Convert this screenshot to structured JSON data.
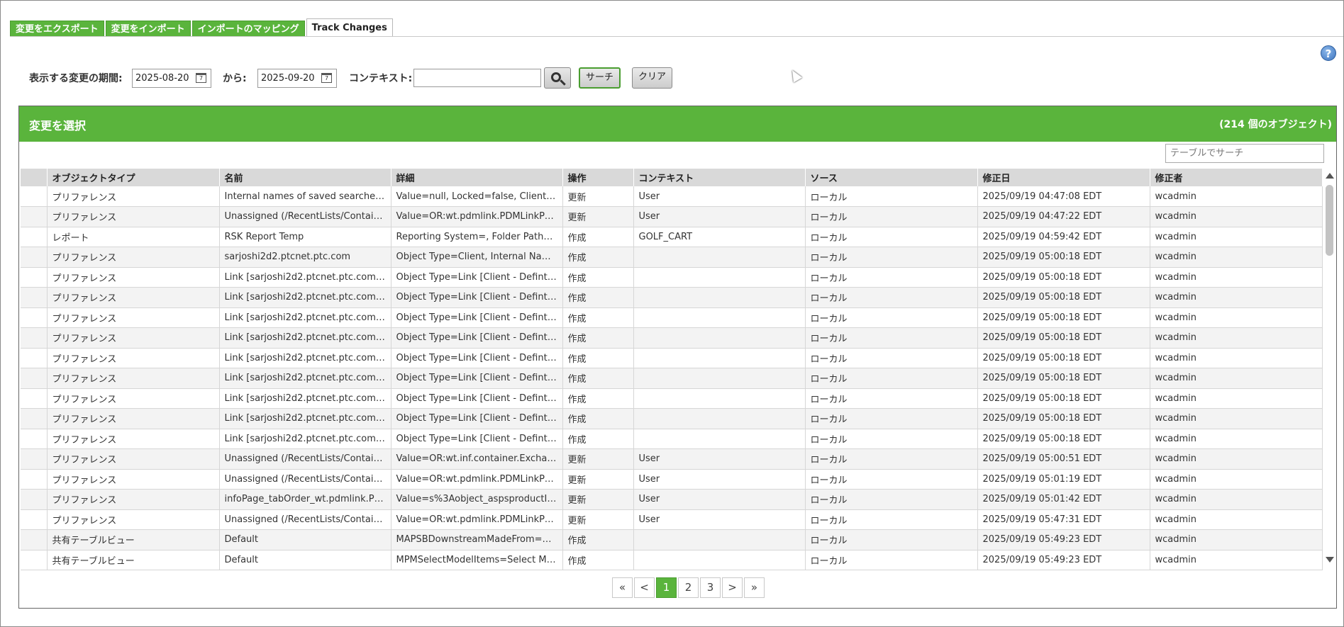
{
  "tabs": [
    {
      "label": "変更をエクスポート"
    },
    {
      "label": "変更をインポート"
    },
    {
      "label": "インポートのマッピング"
    },
    {
      "label": "Track Changes"
    }
  ],
  "help": {
    "symbol": "?"
  },
  "filter": {
    "period_label": "表示する変更の期間:",
    "from_date": "2025-08-20",
    "to_label": "から:",
    "to_date": "2025-09-20",
    "context_label": "コンテキスト:",
    "context_value": "",
    "search_button": "サーチ",
    "clear_button": "クリア"
  },
  "panel": {
    "title": "変更を選択",
    "count": "(214 個のオブジェクト)",
    "table_search_placeholder": "テーブルでサーチ"
  },
  "table": {
    "columns": [
      "オブジェクトタイプ",
      "名前",
      "詳細",
      "操作",
      "コンテキスト",
      "ソース",
      "修正日",
      "修正者"
    ],
    "rows": [
      [
        "プリファレンス",
        "Internal names of saved searches f...",
        "Value=null, Locked=false, Client=...",
        "更新",
        "User",
        "ローカル",
        "2025/09/19 04:47:08 EDT",
        "wcadmin"
      ],
      [
        "プリファレンス",
        "Unassigned (/RecentLists/Contain...",
        "Value=OR:wt.pdmlink.PDMLinkPro...",
        "更新",
        "User",
        "ローカル",
        "2025/09/19 04:47:22 EDT",
        "wcadmin"
      ],
      [
        "レポート",
        "RSK Report Temp",
        "Reporting System=, Folder Path=n...",
        "作成",
        "GOLF_CART",
        "ローカル",
        "2025/09/19 04:59:42 EDT",
        "wcadmin"
      ],
      [
        "プリファレンス",
        "sarjoshi2d2.ptcnet.ptc.com",
        "Object Type=Client, Internal Name...",
        "作成",
        "",
        "ローカル",
        "2025/09/19 05:00:18 EDT",
        "wcadmin"
      ],
      [
        "プリファレンス",
        "Link [sarjoshi2d2.ptcnet.ptc.com - ...",
        "Object Type=Link [Client - Defintio...",
        "作成",
        "",
        "ローカル",
        "2025/09/19 05:00:18 EDT",
        "wcadmin"
      ],
      [
        "プリファレンス",
        "Link [sarjoshi2d2.ptcnet.ptc.com - ...",
        "Object Type=Link [Client - Defintio...",
        "作成",
        "",
        "ローカル",
        "2025/09/19 05:00:18 EDT",
        "wcadmin"
      ],
      [
        "プリファレンス",
        "Link [sarjoshi2d2.ptcnet.ptc.com - ...",
        "Object Type=Link [Client - Defintio...",
        "作成",
        "",
        "ローカル",
        "2025/09/19 05:00:18 EDT",
        "wcadmin"
      ],
      [
        "プリファレンス",
        "Link [sarjoshi2d2.ptcnet.ptc.com - ...",
        "Object Type=Link [Client - Defintio...",
        "作成",
        "",
        "ローカル",
        "2025/09/19 05:00:18 EDT",
        "wcadmin"
      ],
      [
        "プリファレンス",
        "Link [sarjoshi2d2.ptcnet.ptc.com - ...",
        "Object Type=Link [Client - Defintio...",
        "作成",
        "",
        "ローカル",
        "2025/09/19 05:00:18 EDT",
        "wcadmin"
      ],
      [
        "プリファレンス",
        "Link [sarjoshi2d2.ptcnet.ptc.com - ...",
        "Object Type=Link [Client - Defintio...",
        "作成",
        "",
        "ローカル",
        "2025/09/19 05:00:18 EDT",
        "wcadmin"
      ],
      [
        "プリファレンス",
        "Link [sarjoshi2d2.ptcnet.ptc.com - ...",
        "Object Type=Link [Client - Defintio...",
        "作成",
        "",
        "ローカル",
        "2025/09/19 05:00:18 EDT",
        "wcadmin"
      ],
      [
        "プリファレンス",
        "Link [sarjoshi2d2.ptcnet.ptc.com - ...",
        "Object Type=Link [Client - Defintio...",
        "作成",
        "",
        "ローカル",
        "2025/09/19 05:00:18 EDT",
        "wcadmin"
      ],
      [
        "プリファレンス",
        "Link [sarjoshi2d2.ptcnet.ptc.com - ...",
        "Object Type=Link [Client - Defintio...",
        "作成",
        "",
        "ローカル",
        "2025/09/19 05:00:18 EDT",
        "wcadmin"
      ],
      [
        "プリファレンス",
        "Unassigned (/RecentLists/Contain...",
        "Value=OR:wt.inf.container.Exchan...",
        "更新",
        "User",
        "ローカル",
        "2025/09/19 05:00:51 EDT",
        "wcadmin"
      ],
      [
        "プリファレンス",
        "Unassigned (/RecentLists/Contain...",
        "Value=OR:wt.pdmlink.PDMLinkPro...",
        "更新",
        "User",
        "ローカル",
        "2025/09/19 05:01:19 EDT",
        "wcadmin"
      ],
      [
        "プリファレンス",
        "infoPage_tabOrder_wt.pdmlink.PD...",
        "Value=s%3Aobject_aspsproductInf...",
        "更新",
        "User",
        "ローカル",
        "2025/09/19 05:01:42 EDT",
        "wcadmin"
      ],
      [
        "プリファレンス",
        "Unassigned (/RecentLists/Contain...",
        "Value=OR:wt.pdmlink.PDMLinkPro...",
        "更新",
        "User",
        "ローカル",
        "2025/09/19 05:47:31 EDT",
        "wcadmin"
      ],
      [
        "共有テーブルビュー",
        "Default",
        "MAPSBDownstreamMadeFrom=M...",
        "作成",
        "",
        "ローカル",
        "2025/09/19 05:49:23 EDT",
        "wcadmin"
      ],
      [
        "共有テーブルビュー",
        "Default",
        "MPMSelectModelItems=Select Mo...",
        "作成",
        "",
        "ローカル",
        "2025/09/19 05:49:23 EDT",
        "wcadmin"
      ]
    ]
  },
  "pager": {
    "first": "«",
    "prev": "<",
    "pages": [
      "1",
      "2",
      "3"
    ],
    "current": "1",
    "next": ">",
    "last": "»"
  },
  "colors": {
    "accent": "#5ab43c"
  }
}
